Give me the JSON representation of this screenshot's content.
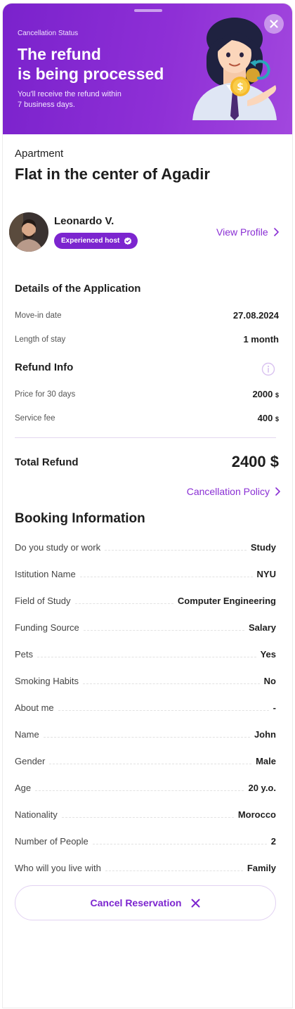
{
  "hero": {
    "kicker": "Cancellation Status",
    "title_line1": "The refund",
    "title_line2": "is being processed",
    "sub_line1": "You'll receive the refund within",
    "sub_line2": "7 business days."
  },
  "listing": {
    "type": "Apartment",
    "title": "Flat in the center of Agadir"
  },
  "host": {
    "name": "Leonardo V.",
    "badge": "Experienced host",
    "view_profile": "View Profile"
  },
  "details": {
    "title": "Details of the Application",
    "rows": [
      {
        "label": "Move-in date",
        "value": "27.08.2024"
      },
      {
        "label": "Length of stay",
        "value": "1 month"
      }
    ]
  },
  "refund": {
    "title": "Refund Info",
    "rows": [
      {
        "label": "Price for 30 days",
        "value": "2000",
        "unit": "$"
      },
      {
        "label": "Service fee",
        "value": "400",
        "unit": "$"
      }
    ],
    "total_label": "Total Refund",
    "total_value": "2400 $",
    "policy_link": "Cancellation Policy"
  },
  "booking": {
    "title": "Booking Information",
    "rows": [
      {
        "label": "Do you study or work",
        "value": "Study"
      },
      {
        "label": "Istitution Name",
        "value": "NYU"
      },
      {
        "label": "Field of Study",
        "value": "Computer Engineering"
      },
      {
        "label": "Funding Source",
        "value": "Salary"
      },
      {
        "label": "Pets",
        "value": "Yes"
      },
      {
        "label": "Smoking Habits",
        "value": "No"
      },
      {
        "label": "About me",
        "value": "-"
      },
      {
        "label": "Name",
        "value": "John"
      },
      {
        "label": "Gender",
        "value": "Male"
      },
      {
        "label": "Age",
        "value": "20 y.o."
      },
      {
        "label": "Nationality",
        "value": "Morocco"
      },
      {
        "label": "Number of People",
        "value": "2"
      },
      {
        "label": "Who will you live with",
        "value": "Family"
      }
    ]
  },
  "actions": {
    "cancel_label": "Cancel Reservation"
  },
  "colors": {
    "accent": "#7c25cf",
    "link": "#8a2fd4",
    "hero_start": "#7a22cc",
    "hero_end": "#a247de"
  }
}
